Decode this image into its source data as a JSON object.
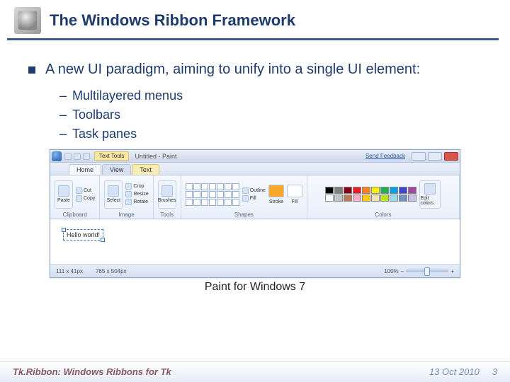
{
  "header": {
    "title": "The Windows Ribbon Framework"
  },
  "bullet": {
    "text": "A new UI paradigm, aiming to unify into a single UI element:"
  },
  "subs": {
    "a": "Multilayered menus",
    "b": "Toolbars",
    "c": "Task panes"
  },
  "paint": {
    "context_tab": "Text Tools",
    "title": "Untitled - Paint",
    "feedback": "Send Feedback",
    "tabs": {
      "home": "Home",
      "view": "View",
      "text": "Text"
    },
    "groups": {
      "clipboard": "Clipboard",
      "image": "Image",
      "tools": "Tools",
      "shapes": "Shapes",
      "colors": "Colors"
    },
    "btns": {
      "paste": "Paste",
      "cut": "Cut",
      "copy": "Copy",
      "select": "Select",
      "crop": "Crop",
      "resize": "Resize",
      "rotate": "Rotate",
      "brushes": "Brushes",
      "outline": "Outline",
      "fill_opt": "Fill",
      "stroke": "Stroke",
      "fill": "Fill",
      "edit_colors": "Edit colors"
    },
    "canvas_text": "Hello world!",
    "status": {
      "pos": "111 x 41px",
      "size": "765 x 504px",
      "zoom": "100%"
    }
  },
  "palette_colors": [
    "#000",
    "#7f7f7f",
    "#880015",
    "#ed1c24",
    "#ff7f27",
    "#fff200",
    "#22b14c",
    "#00a2e8",
    "#3f48cc",
    "#a349a4",
    "#fff",
    "#c3c3c3",
    "#b97a57",
    "#ffaec9",
    "#ffc90e",
    "#efe4b0",
    "#b5e61d",
    "#99d9ea",
    "#7092be",
    "#c8bfe7"
  ],
  "caption": "Paint for Windows 7",
  "footer": {
    "title": "Tk.Ribbon: Windows Ribbons for Tk",
    "date": "13 Oct 2010",
    "page": "3"
  }
}
